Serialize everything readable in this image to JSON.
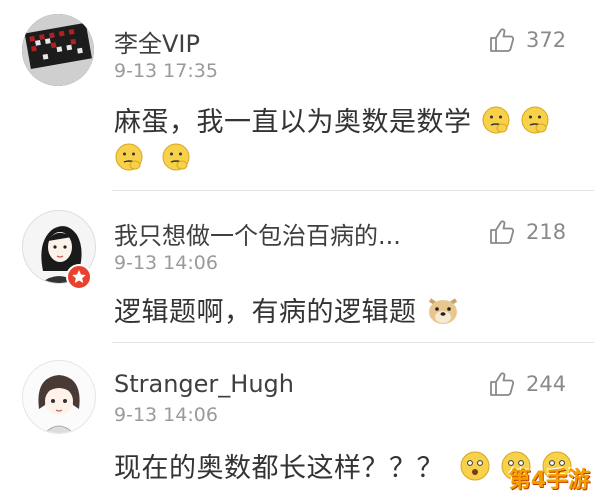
{
  "comments": [
    {
      "username": "李全VIP",
      "time": "9-13 17:35",
      "likes": "372",
      "text_line1": "麻蛋，我一直以为奥数是数学",
      "text_line2": ""
    },
    {
      "username": "我只想做一个包治百病的...",
      "time": "9-13 14:06",
      "likes": "218",
      "text_line1": "逻辑题啊，有病的逻辑题"
    },
    {
      "username": "Stranger_Hugh",
      "time": "9-13 14:06",
      "likes": "244",
      "text_line1": "现在的奥数都长这样？？？"
    }
  ],
  "watermark": "第4手游",
  "colors": {
    "like_icon": "#8a8a8a",
    "time": "#9a9a9a",
    "divider": "#e3e3e3",
    "badge": "#e8412e",
    "watermark": "#f5a000"
  }
}
